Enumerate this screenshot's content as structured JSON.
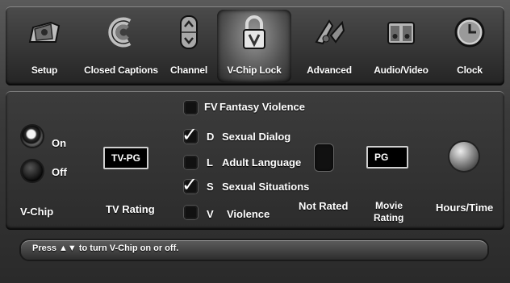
{
  "menu": {
    "items": [
      {
        "label": "Setup",
        "icon": "setup-icon"
      },
      {
        "label": "Closed Captions",
        "icon": "closed-captions-icon"
      },
      {
        "label": "Channel",
        "icon": "channel-updown-icon"
      },
      {
        "label": "V-Chip Lock",
        "icon": "padlock-v-icon"
      },
      {
        "label": "Advanced",
        "icon": "advanced-icon"
      },
      {
        "label": "Audio/Video",
        "icon": "speakers-icon"
      },
      {
        "label": "Clock",
        "icon": "clock-icon"
      }
    ],
    "active": "V-Chip Lock"
  },
  "vchip": {
    "on_label": "On",
    "off_label": "Off",
    "selected": "On",
    "section_label": "V-Chip"
  },
  "tv_rating": {
    "value": "TV-PG",
    "label": "TV Rating"
  },
  "content_ratings": [
    {
      "code": "FV",
      "desc": "Fantasy Violence",
      "checked": false
    },
    {
      "code": "D",
      "desc": "Sexual Dialog",
      "checked": true
    },
    {
      "code": "L",
      "desc": "Adult Language",
      "checked": false
    },
    {
      "code": "S",
      "desc": "Sexual Situations",
      "checked": true
    },
    {
      "code": "V",
      "desc": "Violence",
      "checked": false
    }
  ],
  "not_rated": {
    "label": "Not Rated"
  },
  "movie_rating": {
    "value": "PG",
    "label_line1": "Movie",
    "label_line2": "Rating"
  },
  "hours_time": {
    "label": "Hours/Time"
  },
  "help": {
    "text_before": "Press ",
    "arrows": "▲▼",
    "text_after": " to turn V-Chip on or off."
  },
  "colors": {
    "background": "#3a3a3a",
    "text": "#ffffff",
    "value_box": "#000000"
  }
}
